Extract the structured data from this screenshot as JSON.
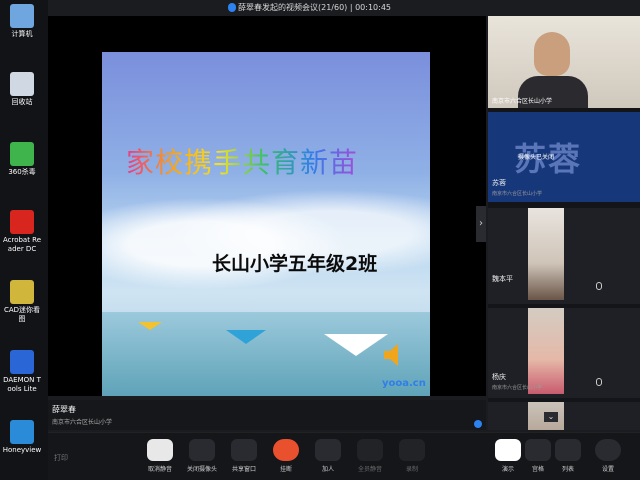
{
  "desktop": {
    "icons": [
      {
        "label": "计算机",
        "icon": "computer-icon",
        "color": "#6fa6e0"
      },
      {
        "label": "回收站",
        "icon": "recycle-bin-icon",
        "color": "#cfd8e3"
      },
      {
        "label": "360杀毒",
        "icon": "shield-icon",
        "color": "#3fb44c"
      },
      {
        "label": "Acrobat Reader DC",
        "icon": "pdf-icon",
        "color": "#d8261f"
      },
      {
        "label": "CAD迷你看图",
        "icon": "cad-icon",
        "color": "#d0b63a"
      },
      {
        "label": "DAEMON Tools Lite",
        "icon": "lightning-icon",
        "color": "#2b66d6"
      },
      {
        "label": "Honeyview",
        "icon": "windows-icon",
        "color": "#2a8bd8"
      }
    ]
  },
  "meeting": {
    "title": "薛翠春发起的视频会议(21/60) | 00:10:45",
    "accent": "#2c82f0",
    "slide": {
      "headline": "家校携手共育新苗",
      "subtitle": "长山小学五年级2班",
      "watermark": "yooa.cn"
    },
    "presenter": {
      "name": "薛翠春",
      "org": "南京市六合区长山小学"
    },
    "participants": [
      {
        "name": "",
        "org": "",
        "caption": "南京市六合区长山小学"
      },
      {
        "name": "苏蓉",
        "org": "南京市六合区长山小学",
        "big_text": "苏蓉",
        "caption": "摄像头已关闭"
      },
      {
        "name": "魏本平",
        "org": ""
      },
      {
        "name": "杨庆",
        "org": "南京市六合区长山小学"
      },
      {
        "name": "",
        "org": ""
      }
    ],
    "toolbar": {
      "left_text": "打印",
      "buttons": [
        {
          "label": "取消静音",
          "icon": "microphone-icon"
        },
        {
          "label": "关闭摄像头",
          "icon": "camera-icon"
        },
        {
          "label": "共享窗口",
          "icon": "share-screen-icon"
        },
        {
          "label": "挂断",
          "icon": "hangup-icon"
        },
        {
          "label": "加人",
          "icon": "add-person-icon"
        },
        {
          "label": "全员静音",
          "icon": "mute-all-icon"
        },
        {
          "label": "录制",
          "icon": "record-icon"
        },
        {
          "label": "演示",
          "icon": "present-icon"
        },
        {
          "label": "宫格",
          "icon": "grid-icon"
        },
        {
          "label": "列表",
          "icon": "list-icon"
        },
        {
          "label": "设置",
          "icon": "gear-icon"
        }
      ]
    }
  }
}
